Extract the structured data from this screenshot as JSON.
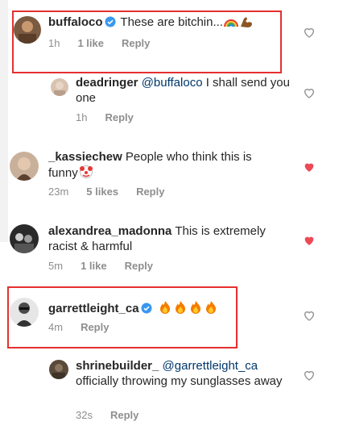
{
  "comments": [
    {
      "username": "buffaloco",
      "text": "These are bitchin...",
      "time": "1h",
      "likes": "1 like",
      "reply": "Reply",
      "liked": false
    },
    {
      "username": "deadringer",
      "mention": "@buffaloco",
      "text": "I shall send you one",
      "time": "1h",
      "likes": "",
      "reply": "Reply",
      "liked": false
    },
    {
      "username": "_kassiechew",
      "text": "People who think this is funny",
      "time": "23m",
      "likes": "5 likes",
      "reply": "Reply",
      "liked": true
    },
    {
      "username": "alexandrea_madonna",
      "text": "This is extremely racist & harmful",
      "time": "5m",
      "likes": "1 like",
      "reply": "Reply",
      "liked": true
    },
    {
      "username": "garrettleight_ca",
      "text": "",
      "time": "4m",
      "likes": "",
      "reply": "Reply",
      "liked": false
    },
    {
      "username": "shrinebuilder_",
      "mention": "@garrettleight_ca",
      "text": "officially throwing my sunglasses away",
      "time": "32s",
      "likes": "",
      "reply": "Reply",
      "liked": false
    }
  ],
  "icons": {
    "heart_outline": "heart-outline-icon",
    "heart_filled": "heart-filled-icon",
    "verified": "verified-badge-icon"
  },
  "colors": {
    "heart_liked": "#ed4956",
    "highlight": "#e53030",
    "verified": "#3897f0"
  }
}
